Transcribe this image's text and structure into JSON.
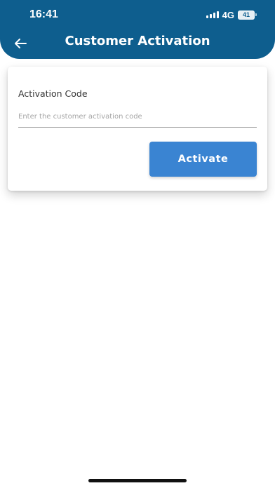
{
  "status_bar": {
    "time": "16:41",
    "network": "4G",
    "battery": "41"
  },
  "header": {
    "title": "Customer Activation",
    "back_icon": "arrow-left-icon",
    "background_color": "#0e5e8e"
  },
  "form": {
    "field_label": "Activation Code",
    "field_placeholder": "Enter the customer activation code",
    "field_value": "",
    "submit_label": "Activate",
    "submit_color": "#3a84d2"
  }
}
